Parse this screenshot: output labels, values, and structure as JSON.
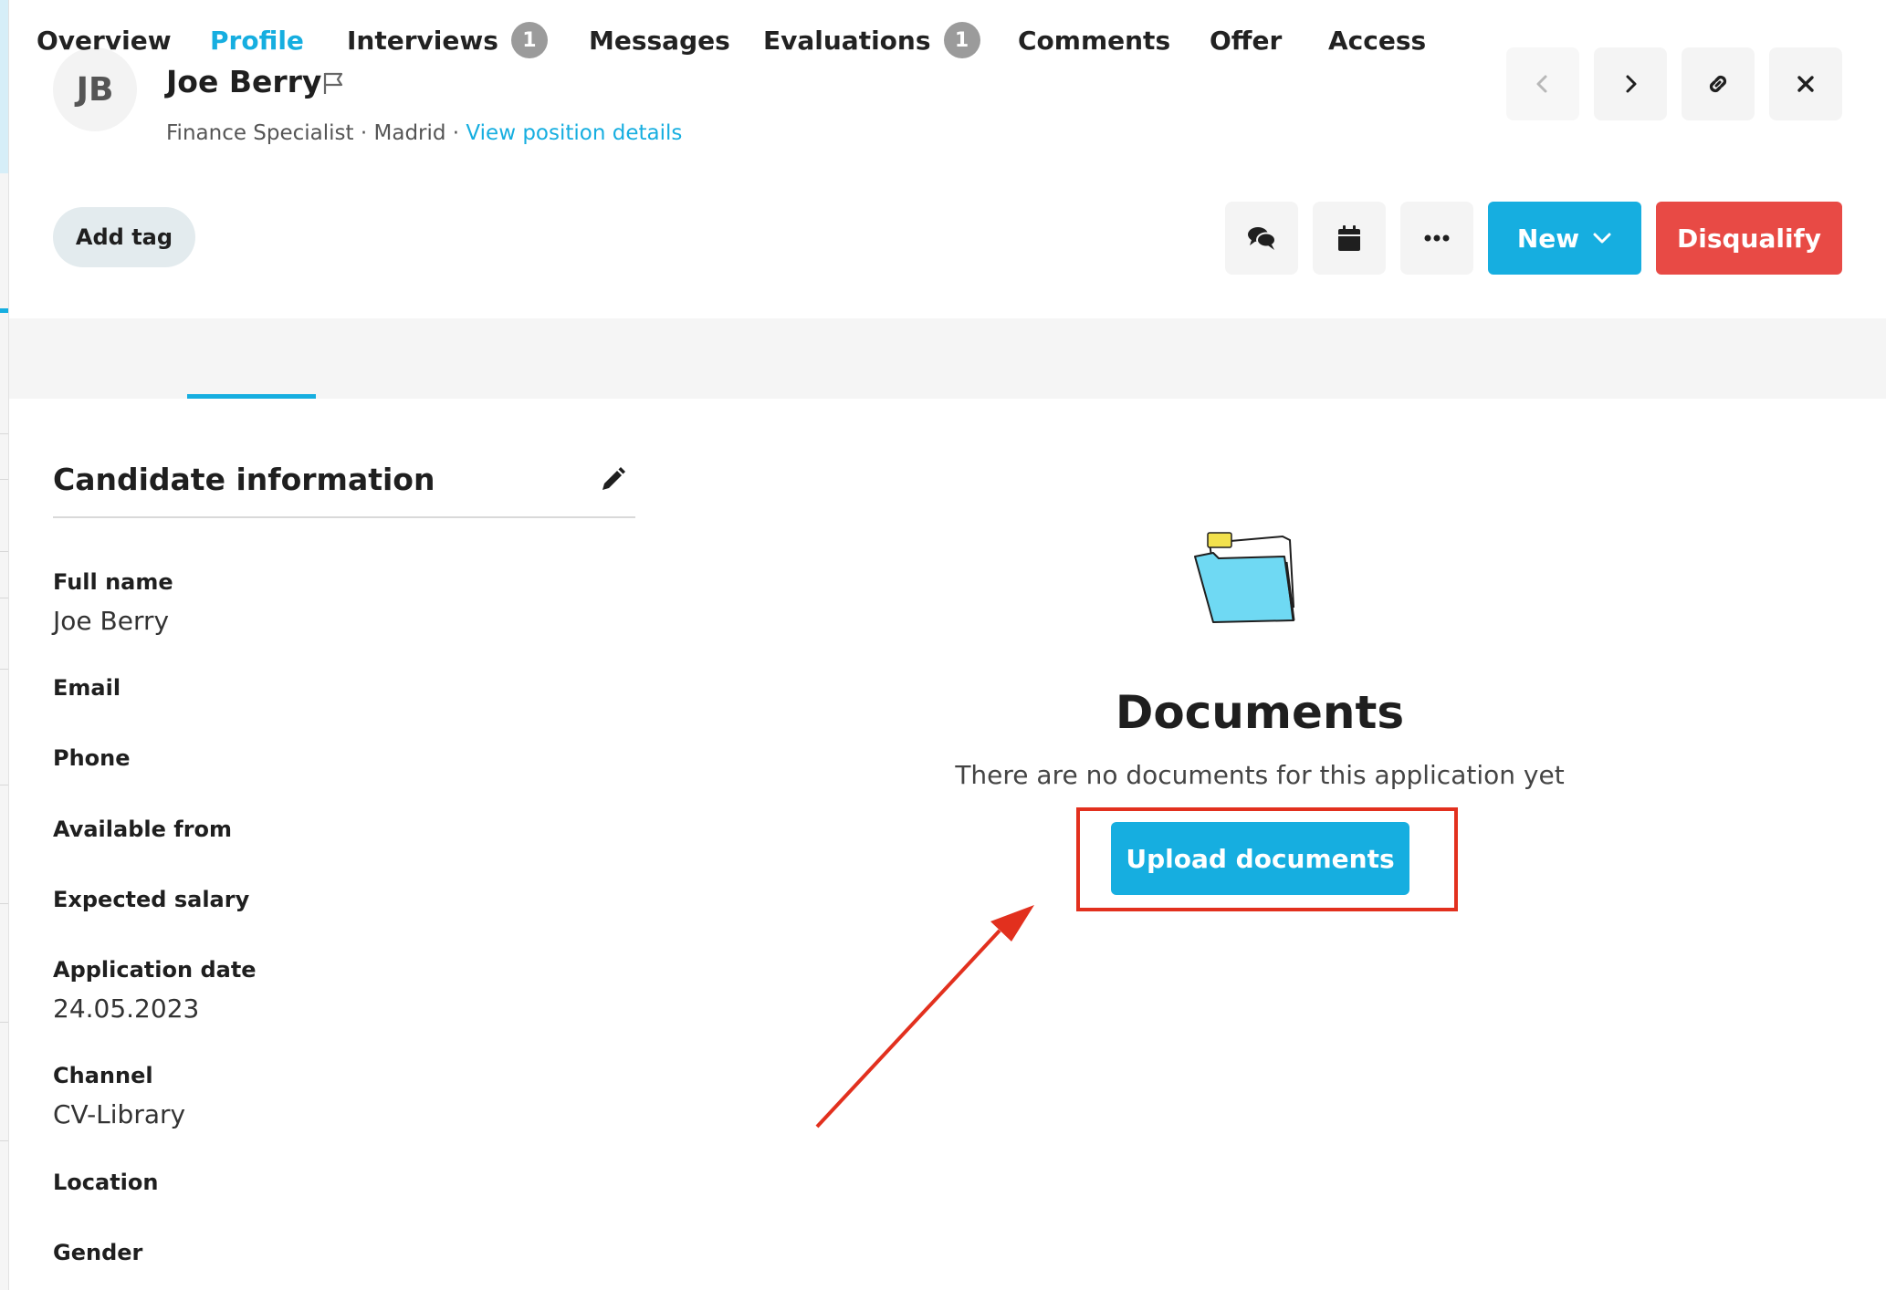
{
  "candidate": {
    "initials": "JB",
    "name": "Joe Berry",
    "position": "Finance Specialist",
    "separator": "·",
    "location": "Madrid",
    "position_link": "View position details"
  },
  "header_icons": [
    "chevron-left-icon",
    "chevron-right-icon",
    "link-icon",
    "close-icon"
  ],
  "actions": {
    "add_tag": "Add tag",
    "new_label": "New",
    "disqualify_label": "Disqualify",
    "action_icons": [
      "chat-icon",
      "calendar-icon",
      "more-icon"
    ]
  },
  "tabs": [
    {
      "label": "Overview"
    },
    {
      "label": "Profile",
      "active": true
    },
    {
      "label": "Interviews",
      "badge": "1"
    },
    {
      "label": "Messages"
    },
    {
      "label": "Evaluations",
      "badge": "1"
    },
    {
      "label": "Comments"
    },
    {
      "label": "Offer"
    },
    {
      "label": "Access"
    }
  ],
  "candidate_info": {
    "title": "Candidate information",
    "fields": [
      {
        "label": "Full name",
        "value": "Joe Berry"
      },
      {
        "label": "Email",
        "value": ""
      },
      {
        "label": "Phone",
        "value": ""
      },
      {
        "label": "Available from",
        "value": ""
      },
      {
        "label": "Expected salary",
        "value": ""
      },
      {
        "label": "Application date",
        "value": "24.05.2023"
      },
      {
        "label": "Channel",
        "value": "CV-Library"
      },
      {
        "label": "Location",
        "value": ""
      },
      {
        "label": "Gender",
        "value": ""
      }
    ]
  },
  "documents": {
    "title": "Documents",
    "empty_text": "There are no documents for this application yet",
    "upload_label": "Upload documents"
  },
  "colors": {
    "accent": "#16aee0",
    "danger": "#e84a45",
    "annotation": "#e2301e"
  }
}
